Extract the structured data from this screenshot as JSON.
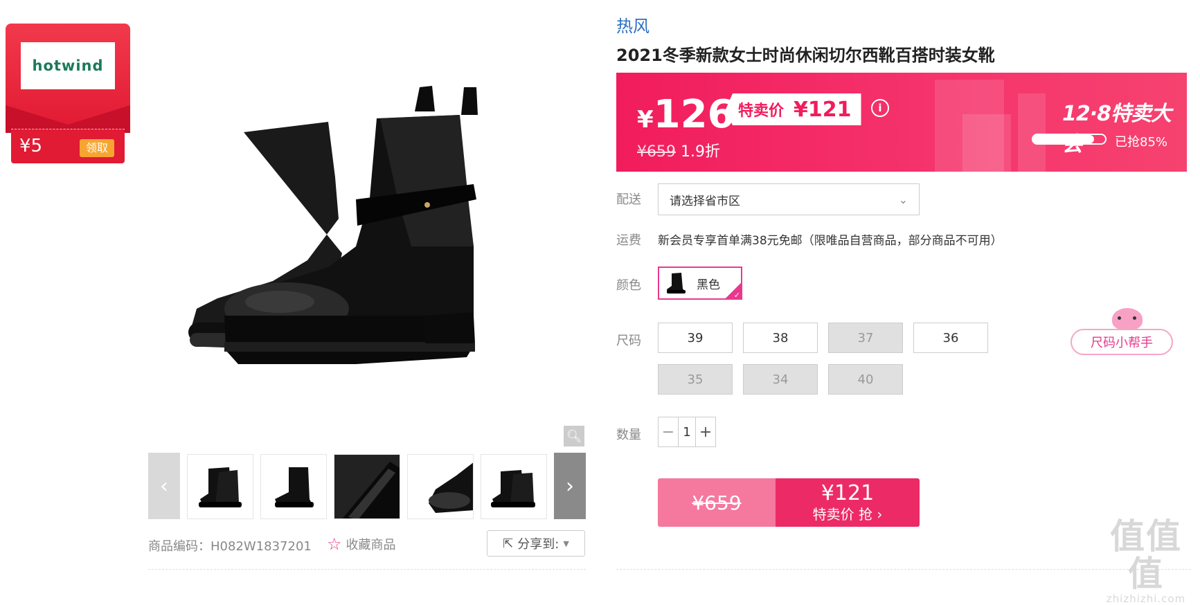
{
  "coupon": {
    "brand_logo": "hotwind",
    "amount": "¥5",
    "claim_label": "领取"
  },
  "gallery": {
    "zoom_icon": "magnifier-icon",
    "prev_icon": "chevron-left-icon",
    "next_icon": "chevron-right-icon",
    "thumbnails": [
      "boot-pair",
      "boot-pair-side",
      "boot-insole",
      "boot-toe",
      "boot-pair-alt"
    ]
  },
  "meta": {
    "sku_code": "商品编码：H082W1837201",
    "favorite_label": "收藏商品",
    "share_label": "分享到:"
  },
  "product": {
    "brand": "热风",
    "title": "2021冬季新款女士时尚休闲切尔西靴百搭时装女靴"
  },
  "price": {
    "currency": "¥",
    "current": "126",
    "special_label": "特卖价",
    "special_price": "¥121",
    "original": "¥659",
    "discount": "1.9折",
    "sale_name": "12·8特卖大会",
    "sold_percent": 0.85,
    "sold_text": "已抢85%"
  },
  "delivery": {
    "label": "配送",
    "placeholder": "请选择省市区"
  },
  "shipping": {
    "label": "运费",
    "text": "新会员专享首单满38元免邮（限唯品自营商品，部分商品不可用）"
  },
  "color": {
    "label": "颜色",
    "selected": "黑色"
  },
  "size": {
    "label": "尺码",
    "options": [
      {
        "value": "39",
        "available": true
      },
      {
        "value": "38",
        "available": true
      },
      {
        "value": "37",
        "available": false
      },
      {
        "value": "36",
        "available": true
      },
      {
        "value": "35",
        "available": false
      },
      {
        "value": "34",
        "available": false
      },
      {
        "value": "40",
        "available": false
      }
    ],
    "helper_label": "尺码小帮手"
  },
  "quantity": {
    "label": "数量",
    "minus": "−",
    "value": "1",
    "plus": "+"
  },
  "buy": {
    "original_price": "¥659",
    "special_price": "¥121",
    "action_label": "特卖价 抢 ›"
  },
  "watermark": {
    "big": "值值值",
    "small": "zhizhizhi.com"
  },
  "colors": {
    "accent": "#f11c5c",
    "pink": "#e8398c",
    "link": "#2b6fc2"
  }
}
